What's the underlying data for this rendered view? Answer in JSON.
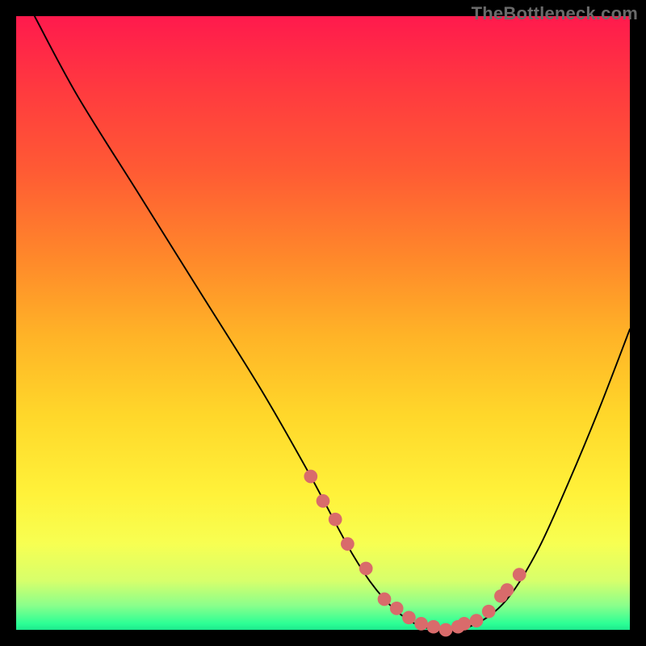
{
  "watermark": "TheBottleneck.com",
  "chart_data": {
    "type": "line",
    "title": "",
    "xlabel": "",
    "ylabel": "",
    "xlim": [
      0,
      100
    ],
    "ylim": [
      0,
      100
    ],
    "grid": false,
    "legend": false,
    "series": [
      {
        "name": "curve",
        "x": [
          3,
          10,
          20,
          30,
          40,
          48,
          55,
          60,
          65,
          70,
          75,
          80,
          85,
          90,
          95,
          100
        ],
        "values": [
          100,
          87,
          71,
          55,
          39,
          25,
          12,
          5,
          1,
          0,
          1,
          5,
          13,
          24,
          36,
          49
        ]
      }
    ],
    "markers": {
      "name": "highlight-points",
      "x": [
        48,
        50,
        52,
        54,
        57,
        60,
        62,
        64,
        66,
        68,
        70,
        72,
        73,
        75,
        77,
        79,
        80,
        82
      ],
      "values": [
        25,
        21,
        18,
        14,
        10,
        5,
        3.5,
        2,
        1,
        0.5,
        0,
        0.5,
        1,
        1.5,
        3,
        5.5,
        6.5,
        9
      ]
    },
    "gradient_stops": [
      {
        "pos": 0.0,
        "color": "#ff1a4d"
      },
      {
        "pos": 0.12,
        "color": "#ff3a3f"
      },
      {
        "pos": 0.25,
        "color": "#ff5a34"
      },
      {
        "pos": 0.4,
        "color": "#ff8a2a"
      },
      {
        "pos": 0.52,
        "color": "#ffb327"
      },
      {
        "pos": 0.65,
        "color": "#ffd72a"
      },
      {
        "pos": 0.78,
        "color": "#fff23a"
      },
      {
        "pos": 0.86,
        "color": "#f7ff52"
      },
      {
        "pos": 0.92,
        "color": "#d7ff6b"
      },
      {
        "pos": 0.96,
        "color": "#8bff8b"
      },
      {
        "pos": 0.99,
        "color": "#2cff95"
      },
      {
        "pos": 1.0,
        "color": "#1de88d"
      }
    ],
    "marker_color": "#d96b6b",
    "curve_color": "#000000"
  }
}
